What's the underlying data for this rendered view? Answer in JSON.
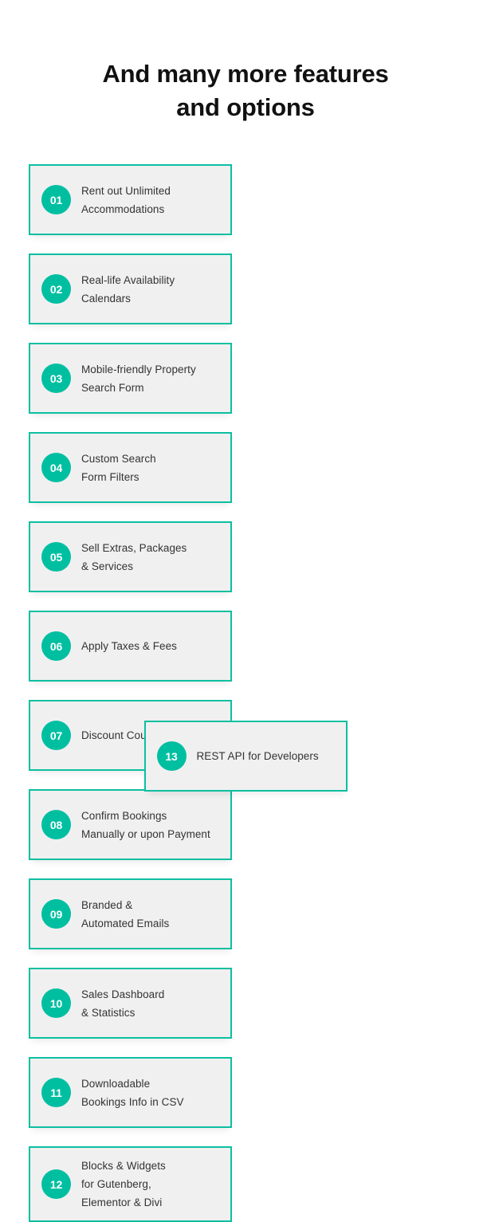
{
  "heading": {
    "line1": "And many more features",
    "line2": "and options"
  },
  "theme": {
    "accent": "#00bfa1",
    "border": "#0cbfa1",
    "card_bg": "#f0f0f0",
    "text": "#333333",
    "heading_text": "#111111",
    "page_bg": "#ffffff"
  },
  "features": [
    {
      "number": "01",
      "lines": [
        "Rent out Unlimited",
        "Accommodations"
      ]
    },
    {
      "number": "02",
      "lines": [
        "Real-life Availability",
        "Calendars"
      ]
    },
    {
      "number": "03",
      "lines": [
        "Mobile-friendly Property",
        "Search Form"
      ]
    },
    {
      "number": "04",
      "lines": [
        "Custom Search",
        "Form Filters"
      ]
    },
    {
      "number": "05",
      "lines": [
        "Sell Extras, Packages",
        "& Services"
      ]
    },
    {
      "number": "06",
      "lines": [
        "Apply Taxes & Fees"
      ]
    },
    {
      "number": "07",
      "lines": [
        "Discount Coupons"
      ]
    },
    {
      "number": "08",
      "lines": [
        "Confirm Bookings",
        "Manually or upon Payment"
      ]
    },
    {
      "number": "09",
      "lines": [
        "Branded &",
        "Automated Emails"
      ]
    },
    {
      "number": "10",
      "lines": [
        "Sales Dashboard",
        "& Statistics"
      ]
    },
    {
      "number": "11",
      "lines": [
        "Downloadable",
        "Bookings Info in CSV"
      ]
    },
    {
      "number": "12",
      "lines": [
        "Blocks & Widgets",
        "for Gutenberg,",
        "Elementor & Divi"
      ]
    }
  ],
  "final_feature": {
    "number": "13",
    "lines": [
      "REST API for Developers"
    ]
  }
}
